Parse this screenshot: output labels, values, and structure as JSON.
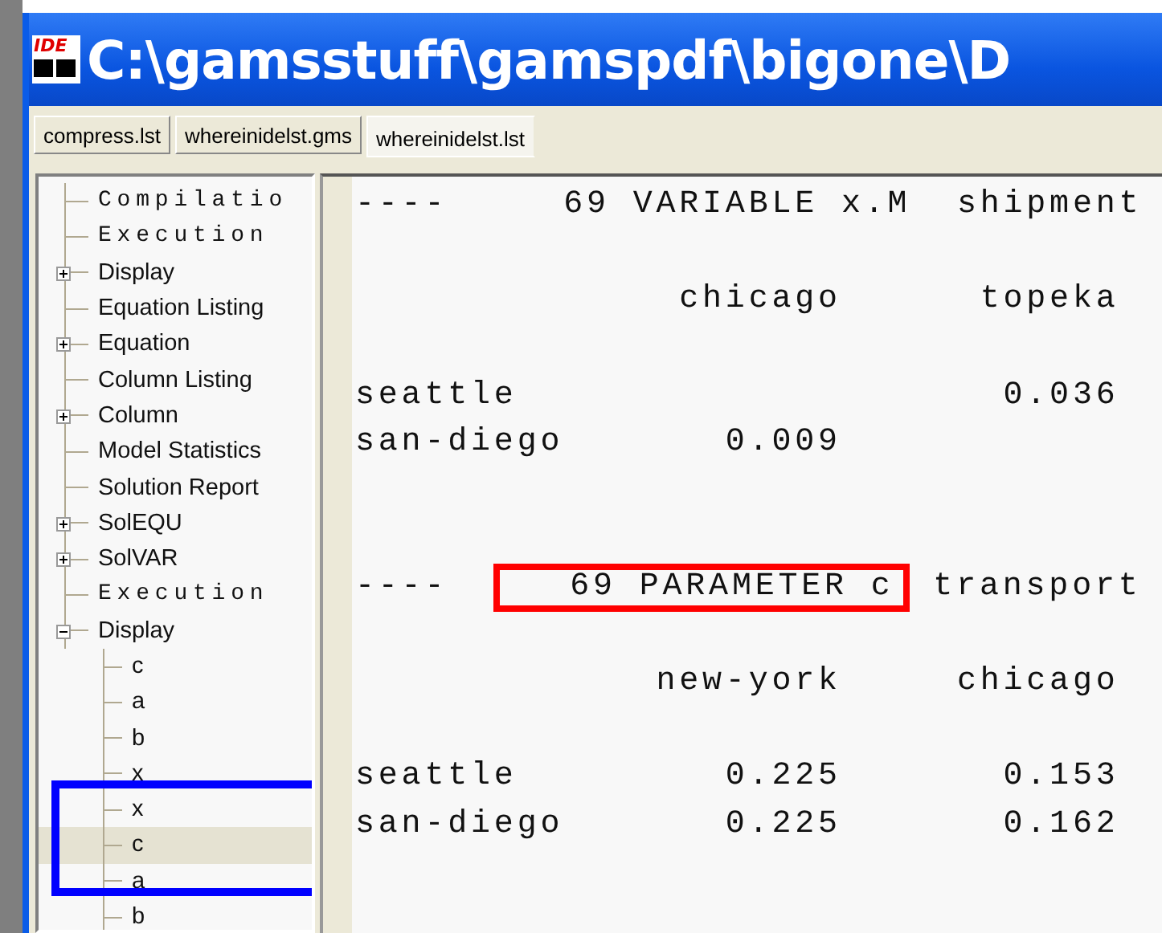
{
  "window": {
    "logo_text": "IDE",
    "title": "C:\\gamsstuff\\gamspdf\\bigone\\D"
  },
  "tabs": [
    {
      "label": "compress.lst",
      "selected": false
    },
    {
      "label": "whereinidelst.gms",
      "selected": false
    },
    {
      "label": "whereinidelst.lst",
      "selected": true
    }
  ],
  "tree": [
    {
      "label": "Compilatio",
      "kind": "banner",
      "selected": false
    },
    {
      "label": "Execution",
      "kind": "banner",
      "selected": false
    },
    {
      "label": "Display",
      "kind": "node",
      "expanded": false,
      "selected": false
    },
    {
      "label": "Equation Listing",
      "kind": "node",
      "selected": false
    },
    {
      "label": "Equation",
      "kind": "node",
      "expanded": false,
      "selected": false
    },
    {
      "label": "Column Listing",
      "kind": "node",
      "selected": false
    },
    {
      "label": "Column",
      "kind": "node",
      "expanded": false,
      "selected": false
    },
    {
      "label": "Model Statistics",
      "kind": "node",
      "selected": false
    },
    {
      "label": "Solution Report",
      "kind": "node",
      "selected": false
    },
    {
      "label": "SolEQU",
      "kind": "node",
      "expanded": false,
      "selected": false
    },
    {
      "label": "SolVAR",
      "kind": "node",
      "expanded": false,
      "selected": false
    },
    {
      "label": "Execution",
      "kind": "banner",
      "selected": false
    },
    {
      "label": "Display",
      "kind": "node",
      "expanded": true,
      "selected": false,
      "children": [
        {
          "label": "c",
          "selected": false
        },
        {
          "label": "a",
          "selected": false
        },
        {
          "label": "b",
          "selected": false
        },
        {
          "label": "x",
          "selected": false
        },
        {
          "label": "x",
          "selected": false
        },
        {
          "label": "c",
          "selected": true
        },
        {
          "label": "a",
          "selected": false
        },
        {
          "label": "b",
          "selected": false
        }
      ]
    }
  ],
  "tree_annotation": {
    "color": "#0000ff"
  },
  "listing": [
    {
      "kind": "text",
      "text": "----     69 VARIABLE x.M  shipment"
    },
    {
      "kind": "blank"
    },
    {
      "kind": "text",
      "text": "              chicago      topeka"
    },
    {
      "kind": "blank"
    },
    {
      "kind": "text",
      "text": "seattle                     0.036"
    },
    {
      "kind": "text",
      "text": "san-diego       0.009"
    },
    {
      "kind": "blank"
    },
    {
      "kind": "blank"
    },
    {
      "kind": "highlight",
      "before": "----  ",
      "boxed": "   69 PARAMETER c",
      "after": " transport",
      "color": "#ff0000"
    },
    {
      "kind": "blank"
    },
    {
      "kind": "text",
      "text": "             new-york     chicago"
    },
    {
      "kind": "blank"
    },
    {
      "kind": "text",
      "text": "seattle         0.225       0.153"
    },
    {
      "kind": "text",
      "text": "san-diego       0.225       0.162"
    }
  ]
}
